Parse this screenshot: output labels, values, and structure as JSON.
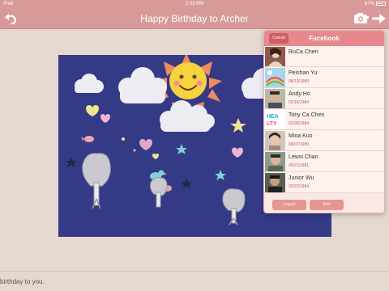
{
  "status_bar": {
    "device": "iPad",
    "time": "2:03 PM",
    "battery": "67%"
  },
  "nav": {
    "title": "Happy Birthday to Archer",
    "back_icon": "undo-arrow-icon",
    "camera_icon": "camera-icon",
    "forward_icon": "forward-arrow-icon"
  },
  "facebook_panel": {
    "title": "Facebook",
    "cancel_label": "Cancel",
    "logout_label": "Logout",
    "sort_label": "Sort",
    "friends": [
      {
        "name": "RuCa Chen",
        "date": ""
      },
      {
        "name": "Peishan Yu",
        "date": "08/13/1989"
      },
      {
        "name": "Andy Ho",
        "date": "02/16/1984"
      },
      {
        "name": "Tony Ca Chen",
        "date": "02/28/1984"
      },
      {
        "name": "Mina Kuo",
        "date": "09/07/1989"
      },
      {
        "name": "Lewsi Chan",
        "date": "05/21/1981"
      },
      {
        "name": "Junior  Wu",
        "date": "03/22/1984"
      }
    ]
  },
  "card": {
    "theme": "birthday drawing"
  },
  "message": {
    "text": "birthday to you."
  },
  "colors": {
    "nav": "#d79a98",
    "background": "#e5d8cf",
    "card": "#343a86",
    "panel_header": "#e7898c"
  }
}
